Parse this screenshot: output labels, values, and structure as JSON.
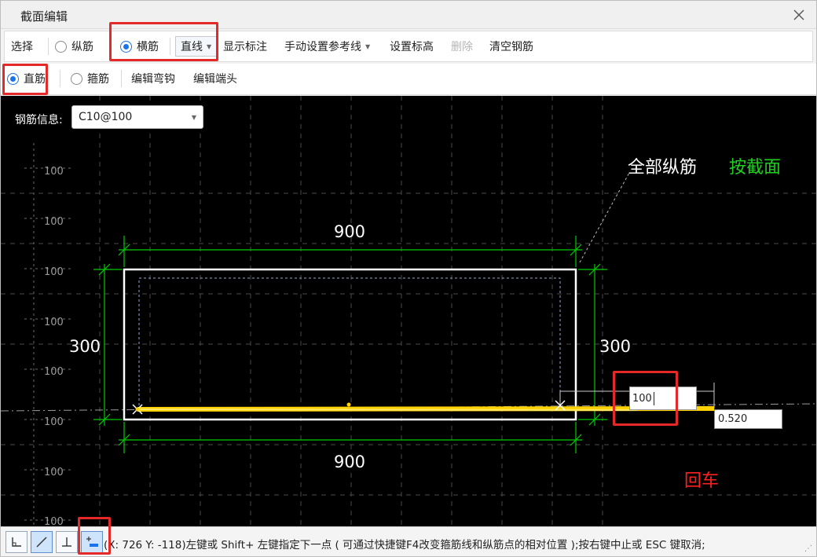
{
  "window": {
    "title": "截面编辑"
  },
  "toolbar1": {
    "select": "选择",
    "longitudinal": "纵筋",
    "transverse": "横筋",
    "line_mode": "直线",
    "show_dims": "显示标注",
    "manual_ref": "手动设置参考线",
    "set_elevation": "设置标高",
    "delete": "删除",
    "clear_rebar": "清空钢筋"
  },
  "toolbar2": {
    "straight": "直筋",
    "stirrup": "箍筋",
    "edit_hook": "编辑弯钩",
    "edit_end": "编辑端头"
  },
  "canvas": {
    "info_label": "钢筋信息:",
    "info_value": "C10@100",
    "grid_labels": [
      "100",
      "100",
      "100",
      "100",
      "100",
      "100",
      "100",
      "100"
    ],
    "dim_top": "900",
    "dim_bottom": "900",
    "dim_left": "300",
    "dim_right": "300",
    "input_value": "100",
    "length_value": "0.520",
    "annot_all": "全部纵筋",
    "annot_section": "按截面",
    "annot_enter": "回车"
  },
  "status": {
    "text": "(X: 726 Y: -118)左键或 Shift+ 左键指定下一点 ( 可通过快捷键F4改变箍筋线和纵筋点的相对位置 );按右键中止或 ESC 键取消;"
  },
  "colors": {
    "canvas_bg": "#000000",
    "section_outline": "#ffffff",
    "dimension": "#00cc00",
    "rebar": "#ffd200",
    "highlight": "#e52828",
    "accent": "#1a73e8"
  }
}
